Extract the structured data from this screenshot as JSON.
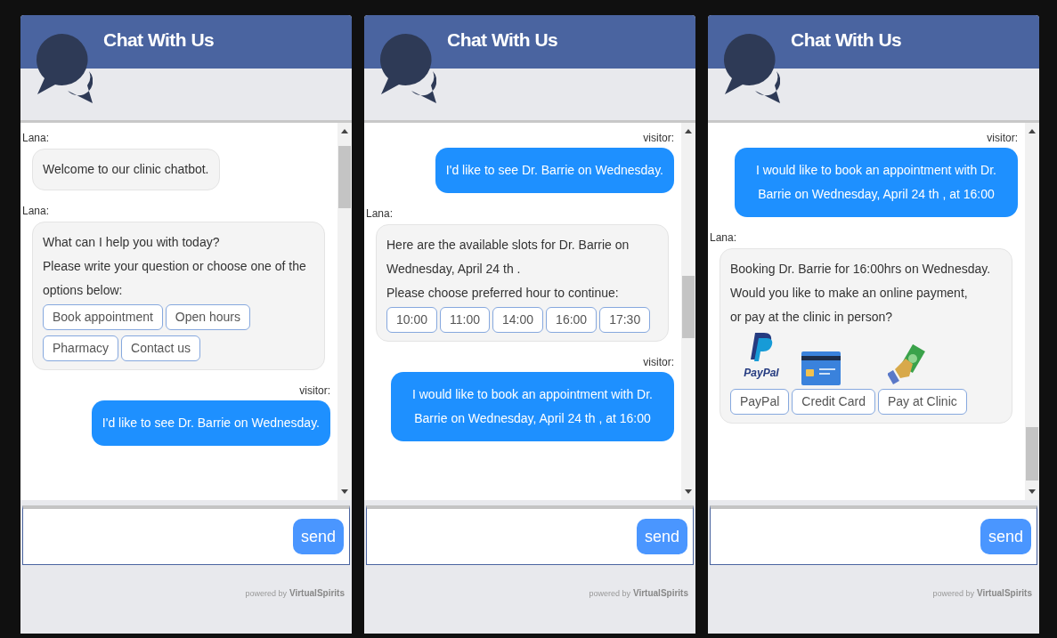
{
  "panels": [
    {
      "title": "Chat With Us",
      "messages": [
        {
          "kind": "bot",
          "sender": "Lana:",
          "lines": [
            "Welcome to our clinic chatbot."
          ]
        },
        {
          "kind": "bot",
          "sender": "Lana:",
          "lines": [
            "What can I help you with today?",
            "Please write your question or choose one of the options below:"
          ],
          "options": [
            {
              "label": "Book appointment",
              "kind": "text"
            },
            {
              "label": "Open hours",
              "kind": "text"
            },
            {
              "label": "Pharmacy",
              "kind": "text"
            },
            {
              "label": "Contact us",
              "kind": "text"
            }
          ]
        },
        {
          "kind": "visitor",
          "sender": "visitor:",
          "lines": [
            "I'd like to see Dr. Barrie on Wednesday."
          ]
        }
      ],
      "send_button": "send",
      "powered_by": "powered by",
      "brand": "VirtualSpirits"
    },
    {
      "title": "Chat With Us",
      "messages": [
        {
          "kind": "visitor",
          "sender": "visitor:",
          "lines": [
            "I'd like to see Dr. Barrie on Wednesday."
          ]
        },
        {
          "kind": "bot",
          "sender": "Lana:",
          "lines": [
            "Here are the available slots for Dr. Barrie on Wednesday, April 24 th .",
            "Please choose preferred hour to continue:"
          ],
          "options": [
            {
              "label": "10:00",
              "kind": "text"
            },
            {
              "label": "11:00",
              "kind": "text"
            },
            {
              "label": "14:00",
              "kind": "text"
            },
            {
              "label": "16:00",
              "kind": "text"
            },
            {
              "label": "17:30",
              "kind": "text"
            }
          ]
        },
        {
          "kind": "visitor",
          "sender": "visitor:",
          "lines": [
            "I would like to book an appointment with Dr. Barrie on Wednesday, April 24 th , at 16:00"
          ]
        }
      ],
      "send_button": "send",
      "powered_by": "powered by",
      "brand": "VirtualSpirits"
    },
    {
      "title": "Chat With Us",
      "messages": [
        {
          "kind": "visitor",
          "sender": "visitor:",
          "lines": [
            "I would like to book an appointment with Dr. Barrie on Wednesday, April 24 th , at 16:00"
          ]
        },
        {
          "kind": "bot",
          "sender": "Lana:",
          "lines": [
            "Booking Dr. Barrie for 16:00hrs on Wednesday. Would you like to make an online payment,",
            "or pay at the clinic in person?"
          ],
          "options": [
            {
              "label": "PayPal",
              "kind": "paypal",
              "logo_text": "PayPal"
            },
            {
              "label": "Credit Card",
              "kind": "card"
            },
            {
              "label": "Pay at Clinic",
              "kind": "cash"
            }
          ]
        }
      ],
      "send_button": "send",
      "powered_by": "powered by",
      "brand": "VirtualSpirits"
    }
  ]
}
